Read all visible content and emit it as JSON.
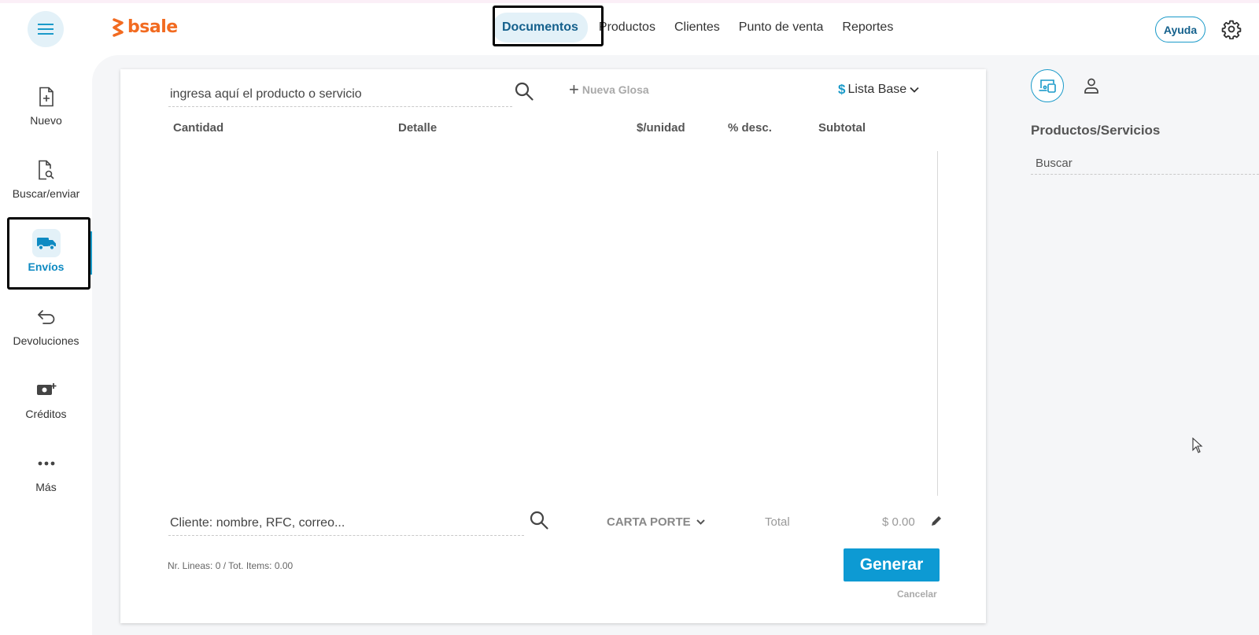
{
  "app": {
    "logo_text": "bsale",
    "brand_color": "#f26b21",
    "accent_color": "#1a9ac9"
  },
  "header": {
    "menu_icon": "hamburger-menu-icon",
    "nav": [
      {
        "label": "Documentos",
        "active": true
      },
      {
        "label": "Productos",
        "active": false
      },
      {
        "label": "Clientes",
        "active": false
      },
      {
        "label": "Punto de venta",
        "active": false
      },
      {
        "label": "Reportes",
        "active": false
      }
    ],
    "help_label": "Ayuda",
    "settings_icon": "gear-icon"
  },
  "sidebar": {
    "items": [
      {
        "label": "Nuevo",
        "icon": "file-plus-icon",
        "active": false
      },
      {
        "label": "Buscar/enviar",
        "icon": "file-search-icon",
        "active": false
      },
      {
        "label": "Envíos",
        "icon": "truck-icon",
        "active": true
      },
      {
        "label": "Devoluciones",
        "icon": "return-arrow-icon",
        "active": false
      },
      {
        "label": "Créditos",
        "icon": "cash-plus-icon",
        "active": false
      },
      {
        "label": "Más",
        "icon": "more-dots-icon",
        "active": false
      }
    ]
  },
  "document": {
    "product_placeholder": "ingresa aquí el producto o servicio",
    "nueva_glosa_label": "Nueva Glosa",
    "price_list_symbol": "$",
    "price_list_label": "Lista Base",
    "columns": [
      "Cantidad",
      "Detalle",
      "$/unidad",
      "% desc.",
      "Subtotal"
    ],
    "rows": [],
    "client_placeholder": "Cliente: nombre, RFC, correo...",
    "doc_type_label": "CARTA PORTE",
    "total_label": "Total",
    "total_value": "$ 0.00",
    "summary": "Nr. Lineas: 0 / Tot. Items: 0.00",
    "generate_label": "Generar",
    "cancel_label": "Cancelar"
  },
  "right_panel": {
    "title": "Productos/Servicios",
    "search_placeholder": "Buscar"
  }
}
